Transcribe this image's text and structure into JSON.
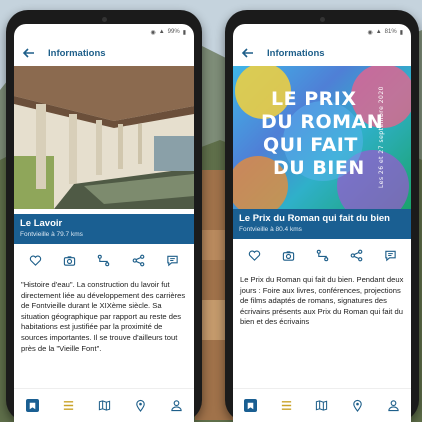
{
  "left_phone": {
    "status": {
      "battery": "99%"
    },
    "header": {
      "title": "Informations"
    },
    "place": {
      "title": "Le Lavoir",
      "subtitle": "Fontvieille à 79.7 kms",
      "description": "\"Histoire d'eau\". La construction du lavoir fut directement liée au développement des carrières de Fontvieille durant le XIXème siècle. Sa situation géographique par rapport au reste des habitations est justifiée par la proximité de sources importantes. Il se trouve d'ailleurs tout près de la \"Vieille Font\"."
    }
  },
  "right_phone": {
    "status": {
      "battery": "81%"
    },
    "header": {
      "title": "Informations"
    },
    "poster": {
      "line1": "LE PRIX",
      "line2": "DU ROMAN",
      "line3": "QUI FAIT",
      "line4": "DU BIEN",
      "dates": "Les 26 et 27 septembre 2020"
    },
    "place": {
      "title": "Le Prix du Roman qui fait du bien",
      "subtitle": "Fontvieille à 80.4 kms",
      "description": "Le Prix du Roman qui fait du bien. Pendant deux jours : Foire aux livres, conférences, projections de films adaptés de romans, signatures des écrivains présents aux Prix du Roman qui fait du bien et des écrivains"
    }
  },
  "icons": {
    "actions": [
      "heart-icon",
      "camera-icon",
      "route-icon",
      "share-icon",
      "chat-icon"
    ],
    "nav": [
      "map-book-icon",
      "list-icon",
      "map-icon",
      "pin-icon",
      "user-icon"
    ]
  },
  "colors": {
    "accent": "#1a5f92",
    "icon": "#1e5f8a"
  }
}
